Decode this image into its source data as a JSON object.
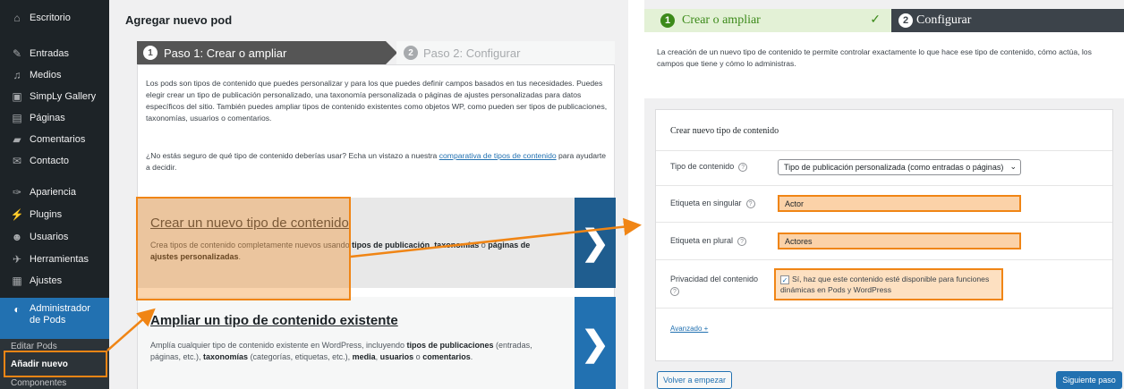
{
  "sidebar": {
    "items": [
      {
        "label": "Escritorio",
        "icon": "dashboard-icon",
        "glyph": "⌂"
      },
      {
        "label": "Entradas",
        "icon": "pin-icon",
        "glyph": "✎"
      },
      {
        "label": "Medios",
        "icon": "media-icon",
        "glyph": "♫"
      },
      {
        "label": "SimpLy Gallery",
        "icon": "gallery-icon",
        "glyph": "▣"
      },
      {
        "label": "Páginas",
        "icon": "pages-icon",
        "glyph": "▤"
      },
      {
        "label": "Comentarios",
        "icon": "comments-icon",
        "glyph": "▰"
      },
      {
        "label": "Contacto",
        "icon": "mail-icon",
        "glyph": "✉"
      },
      {
        "label": "Apariencia",
        "icon": "appearance-icon",
        "glyph": "✑"
      },
      {
        "label": "Plugins",
        "icon": "plugins-icon",
        "glyph": "⚡"
      },
      {
        "label": "Usuarios",
        "icon": "users-icon",
        "glyph": "☻"
      },
      {
        "label": "Herramientas",
        "icon": "tools-icon",
        "glyph": "✈"
      },
      {
        "label": "Ajustes",
        "icon": "settings-icon",
        "glyph": "▦"
      }
    ],
    "active": {
      "label": "Administrador de Pods",
      "icon": "pods-icon",
      "glyph": "◐"
    },
    "submenu": [
      "Editar Pods",
      "Añadir nuevo",
      "Componentes"
    ]
  },
  "left": {
    "page_title": "Agregar nuevo pod",
    "step1": {
      "number": "1",
      "label": "Paso 1: Crear o ampliar"
    },
    "step2": {
      "number": "2",
      "label": "Paso 2: Configurar"
    },
    "intro": "Los pods son tipos de contenido que puedes personalizar y para los que puedes definir campos basados en tus necesidades. Puedes elegir crear un tipo de publicación personalizado, una taxonomía personalizada o páginas de ajustes personalizadas para datos específicos del sitio. También puedes ampliar tipos de contenido existentes como objetos WP, como pueden ser tipos de publicaciones, taxonomías, usuarios o comentarios.",
    "intro2_before": "¿No estás seguro de qué tipo de contenido deberías usar? Echa un vistazo a nuestra ",
    "intro2_link": "comparativa de tipos de contenido",
    "intro2_after": " para ayudarte a decidir.",
    "card1": {
      "title": "Crear un nuevo tipo de contenido",
      "desc_1": "Crea tipos de contenido completamente nuevos usando ",
      "desc_b1": "tipos de publicación",
      "desc_2": ", ",
      "desc_b2": "taxonomías",
      "desc_3": " o ",
      "desc_b3": "páginas de ajustes personalizadas",
      "desc_4": ".",
      "arrow": "❯"
    },
    "card2": {
      "title": "Ampliar un tipo de contenido existente",
      "desc_1": "Amplía cualquier tipo de contenido existente en WordPress, incluyendo ",
      "desc_b1": "tipos de publicaciones",
      "desc_2": " (entradas, páginas, etc.), ",
      "desc_b2": "taxonomías",
      "desc_3": " (categorías, etiquetas, etc.), ",
      "desc_b3": "media",
      "desc_4": ", ",
      "desc_b4": "usuarios",
      "desc_5": " o ",
      "desc_b5": "comentarios",
      "desc_6": ".",
      "arrow": "❯"
    }
  },
  "right": {
    "step1": {
      "number": "1",
      "label": "Crear o ampliar",
      "check": "✓"
    },
    "step2": {
      "number": "2",
      "label": "Configurar"
    },
    "intro": "La creación de un nuevo tipo de contenido te permite controlar exactamente lo que hace ese tipo de contenido, cómo actúa, los campos que tiene y cómo lo administras.",
    "form": {
      "title": "Crear nuevo tipo de contenido",
      "type_label": "Tipo de contenido",
      "type_value": "Tipo de publicación personalizada (como entradas o páginas)",
      "singular_label": "Etiqueta en singular",
      "singular_value": "Actor",
      "plural_label": "Etiqueta en plural",
      "plural_value": "Actores",
      "privacy_label": "Privacidad del contenido",
      "privacy_text": "Sí, haz que este contenido esté disponible para funciones dinámicas en Pods y WordPress",
      "advanced": "Avanzado +",
      "help": "?"
    },
    "back_button": "Volver a empezar",
    "next_button": "Siguiente paso"
  },
  "colors": {
    "highlight": "#f08515",
    "accent": "#2271b1",
    "sidebar": "#1d2327"
  }
}
